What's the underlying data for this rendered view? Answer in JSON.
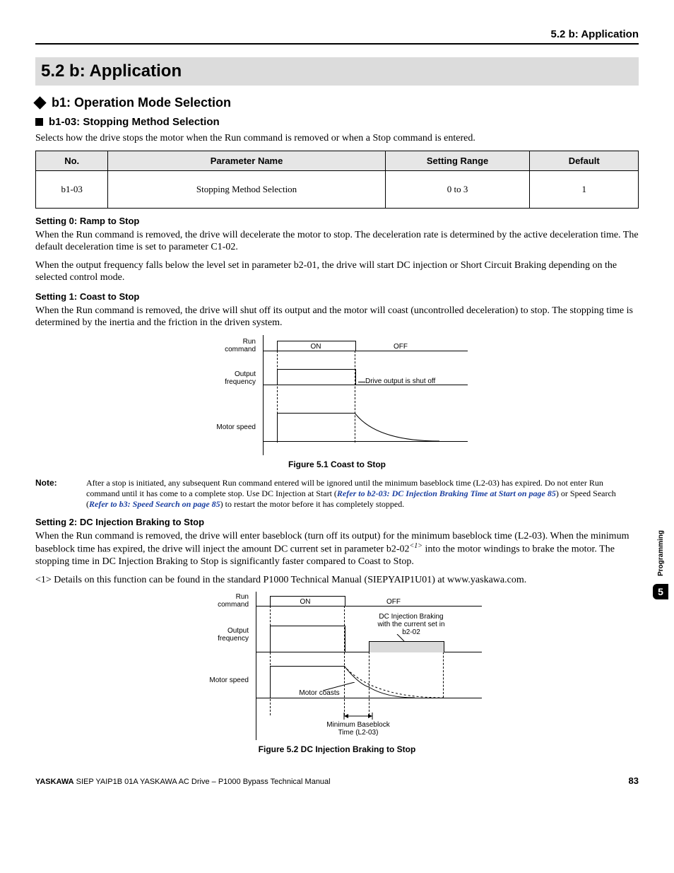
{
  "header": {
    "breadcrumb": "5.2  b: Application"
  },
  "section": {
    "title": "5.2   b: Application"
  },
  "h2": {
    "b1": "b1: Operation Mode Selection"
  },
  "h3": {
    "b103": "b1-03: Stopping Method Selection"
  },
  "intro": "Selects how the drive stops the motor when the Run command is removed or when a Stop command is entered.",
  "table": {
    "headers": {
      "no": "No.",
      "name": "Parameter Name",
      "range": "Setting Range",
      "def": "Default"
    },
    "row": {
      "no": "b1-03",
      "name": "Stopping Method Selection",
      "range": "0 to 3",
      "def": "1"
    }
  },
  "s0": {
    "title": "Setting 0: Ramp to Stop",
    "p1": "When the Run command is removed, the drive will decelerate the motor to stop. The deceleration rate is determined by the active deceleration time. The default deceleration time is set to parameter C1-02.",
    "p2": "When the output frequency falls below the level set in parameter b2-01, the drive will start DC injection or Short Circuit Braking depending on the selected control mode."
  },
  "s1": {
    "title": "Setting 1: Coast to Stop",
    "p1": "When the Run command is removed, the drive will shut off its output and the motor will coast (uncontrolled deceleration) to stop. The stopping time is determined by the inertia and the friction in the driven system."
  },
  "fig1": {
    "caption": "Figure 5.1  Coast to Stop",
    "labels": {
      "run": "Run\ncommand",
      "out": "Output\nfrequency",
      "motor": "Motor speed",
      "on": "ON",
      "off": "OFF",
      "shut": "Drive output is shut off"
    }
  },
  "note": {
    "label": "Note:",
    "t1": "After a stop is initiated, any subsequent Run command entered will be ignored until the minimum baseblock time (L2-03) has expired. Do not enter Run command until it has come to a complete stop. Use DC Injection at Start (",
    "l1": "Refer to b2-03: DC Injection Braking Time at Start on page 85",
    "t2": ") or Speed Search (",
    "l2": "Refer to b3: Speed Search on page 85",
    "t3": ") to restart the motor before it has completely stopped."
  },
  "s2": {
    "title": "Setting 2: DC Injection Braking to Stop",
    "p1a": "When the Run command is removed, the drive will enter baseblock (turn off its output) for the minimum baseblock time (L2-03). When the minimum baseblock time has expired, the drive will inject the amount DC current set in parameter b2-02",
    "sup": "<1>",
    "p1b": " into the motor windings to brake the motor. The stopping time in DC Injection Braking to Stop is significantly faster compared to Coast to Stop.",
    "p2": "<1> Details on this function can be found in the standard P1000 Technical Manual (SIEPYAIP1U01) at www.yaskawa.com."
  },
  "fig2": {
    "caption": "Figure 5.2  DC Injection Braking to Stop",
    "labels": {
      "run": "Run\ncommand",
      "out": "Output\nfrequency",
      "motor": "Motor speed",
      "on": "ON",
      "off": "OFF",
      "dc": "DC Injection Braking\nwith the current set in\nb2-02",
      "coast": "Motor coasts",
      "bb": "Minimum Baseblock\nTime (L2-03)"
    }
  },
  "side": {
    "label": "Programming",
    "num": "5"
  },
  "footer": {
    "brand": "YASKAWA",
    "doc": " SIEP YAIP1B 01A YASKAWA AC Drive – P1000 Bypass Technical Manual",
    "page": "83"
  },
  "chart_data": [
    {
      "type": "line",
      "title": "Coast to Stop",
      "signals": {
        "run_command": {
          "on_until": 0.5,
          "states": [
            "ON",
            "OFF"
          ]
        },
        "output_frequency": {
          "drops_at": 0.5,
          "note": "Drive output is shut off"
        },
        "motor_speed": {
          "curve": "decay_to_zero_after_0.5"
        }
      }
    },
    {
      "type": "line",
      "title": "DC Injection Braking to Stop",
      "signals": {
        "run_command": {
          "on_until": 0.5,
          "states": [
            "ON",
            "OFF"
          ]
        },
        "output_frequency": {
          "drops_at": 0.5,
          "dc_injection_start": 0.62,
          "dc_injection_level": 0.3,
          "label": "DC Injection Braking with the current set in b2-02"
        },
        "motor_speed": {
          "coast_until": 0.62,
          "brake_to_zero_by": 0.9,
          "coast_label": "Motor coasts"
        },
        "min_baseblock": {
          "from": 0.5,
          "to": 0.62,
          "label": "Minimum Baseblock Time (L2-03)"
        }
      }
    }
  ]
}
